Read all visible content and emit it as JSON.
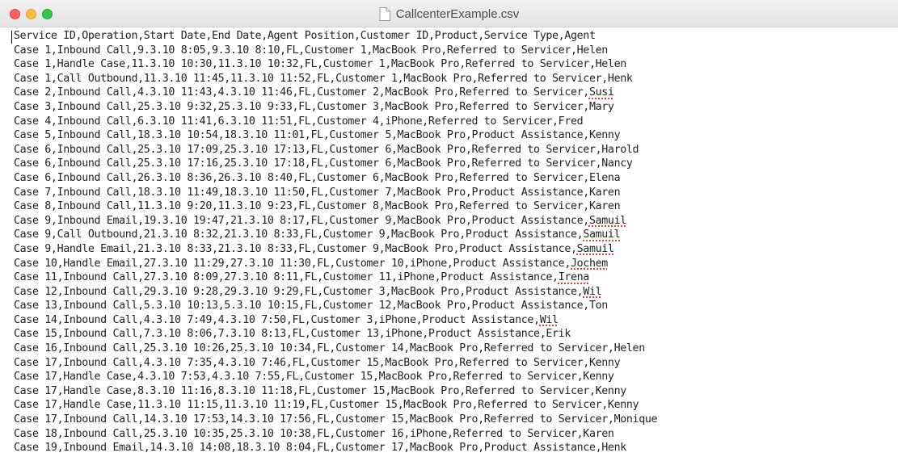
{
  "window": {
    "title": "CallcenterExample.csv",
    "title_icon": "document-icon"
  },
  "editor": {
    "lines": [
      "Service ID,Operation,Start Date,End Date,Agent Position,Customer ID,Product,Service Type,Agent",
      "Case 1,Inbound Call,9.3.10 8:05,9.3.10 8:10,FL,Customer 1,MacBook Pro,Referred to Servicer,Helen",
      "Case 1,Handle Case,11.3.10 10:30,11.3.10 10:32,FL,Customer 1,MacBook Pro,Referred to Servicer,Helen",
      "Case 1,Call Outbound,11.3.10 11:45,11.3.10 11:52,FL,Customer 1,MacBook Pro,Referred to Servicer,Henk",
      "Case 2,Inbound Call,4.3.10 11:43,4.3.10 11:46,FL,Customer 2,MacBook Pro,Referred to Servicer,Susi",
      "Case 3,Inbound Call,25.3.10 9:32,25.3.10 9:33,FL,Customer 3,MacBook Pro,Referred to Servicer,Mary",
      "Case 4,Inbound Call,6.3.10 11:41,6.3.10 11:51,FL,Customer 4,iPhone,Referred to Servicer,Fred",
      "Case 5,Inbound Call,18.3.10 10:54,18.3.10 11:01,FL,Customer 5,MacBook Pro,Product Assistance,Kenny",
      "Case 6,Inbound Call,25.3.10 17:09,25.3.10 17:13,FL,Customer 6,MacBook Pro,Referred to Servicer,Harold",
      "Case 6,Inbound Call,25.3.10 17:16,25.3.10 17:18,FL,Customer 6,MacBook Pro,Referred to Servicer,Nancy",
      "Case 6,Inbound Call,26.3.10 8:36,26.3.10 8:40,FL,Customer 6,MacBook Pro,Referred to Servicer,Elena",
      "Case 7,Inbound Call,18.3.10 11:49,18.3.10 11:50,FL,Customer 7,MacBook Pro,Product Assistance,Karen",
      "Case 8,Inbound Call,11.3.10 9:20,11.3.10 9:23,FL,Customer 8,MacBook Pro,Referred to Servicer,Karen",
      "Case 9,Inbound Email,19.3.10 19:47,21.3.10 8:17,FL,Customer 9,MacBook Pro,Product Assistance,Samuil",
      "Case 9,Call Outbound,21.3.10 8:32,21.3.10 8:33,FL,Customer 9,MacBook Pro,Product Assistance,Samuil",
      "Case 9,Handle Email,21.3.10 8:33,21.3.10 8:33,FL,Customer 9,MacBook Pro,Product Assistance,Samuil",
      "Case 10,Handle Email,27.3.10 11:29,27.3.10 11:30,FL,Customer 10,iPhone,Product Assistance,Jochem",
      "Case 11,Inbound Call,27.3.10 8:09,27.3.10 8:11,FL,Customer 11,iPhone,Product Assistance,Irena",
      "Case 12,Inbound Call,29.3.10 9:28,29.3.10 9:29,FL,Customer 3,MacBook Pro,Product Assistance,Wil",
      "Case 13,Inbound Call,5.3.10 10:13,5.3.10 10:15,FL,Customer 12,MacBook Pro,Product Assistance,Ton",
      "Case 14,Inbound Call,4.3.10 7:49,4.3.10 7:50,FL,Customer 3,iPhone,Product Assistance,Wil",
      "Case 15,Inbound Call,7.3.10 8:06,7.3.10 8:13,FL,Customer 13,iPhone,Product Assistance,Erik",
      "Case 16,Inbound Call,25.3.10 10:26,25.3.10 10:34,FL,Customer 14,MacBook Pro,Referred to Servicer,Helen",
      "Case 17,Inbound Call,4.3.10 7:35,4.3.10 7:46,FL,Customer 15,MacBook Pro,Referred to Servicer,Kenny",
      "Case 17,Handle Case,4.3.10 7:53,4.3.10 7:55,FL,Customer 15,MacBook Pro,Referred to Servicer,Kenny",
      "Case 17,Handle Case,8.3.10 11:16,8.3.10 11:18,FL,Customer 15,MacBook Pro,Referred to Servicer,Kenny",
      "Case 17,Handle Case,11.3.10 11:15,11.3.10 11:19,FL,Customer 15,MacBook Pro,Referred to Servicer,Kenny",
      "Case 17,Inbound Call,14.3.10 17:53,14.3.10 17:56,FL,Customer 15,MacBook Pro,Referred to Servicer,Monique",
      "Case 18,Inbound Call,25.3.10 10:35,25.3.10 10:38,FL,Customer 16,iPhone,Referred to Servicer,Karen",
      "Case 19,Inbound Email,14.3.10 14:08,18.3.10 8:04,FL,Customer 17,MacBook Pro,Product Assistance,Henk"
    ],
    "misspelled_words": [
      "Susi",
      "Samuil",
      "Jochem",
      "Irena",
      "Wil"
    ]
  }
}
